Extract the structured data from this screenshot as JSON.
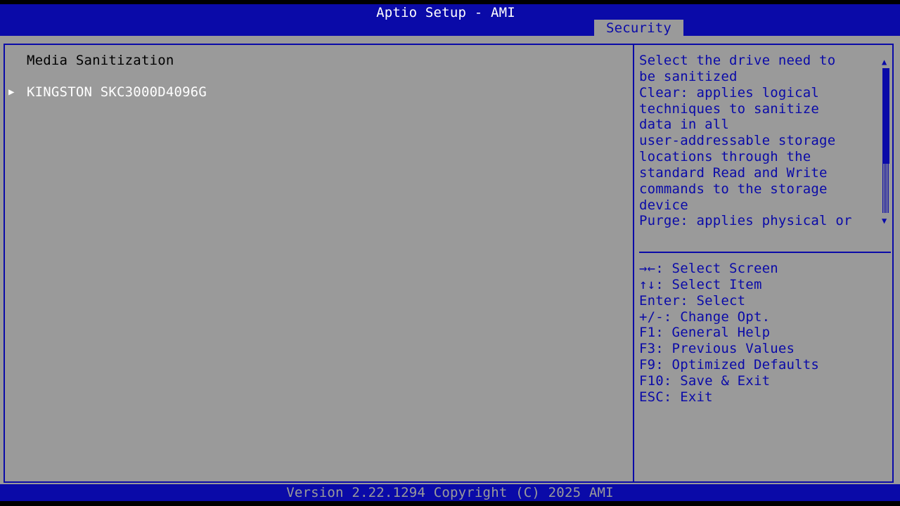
{
  "header": {
    "title": "Aptio Setup - AMI",
    "active_tab": "Security"
  },
  "main": {
    "section_title": "Media Sanitization",
    "items": [
      {
        "pointer_icon": "right-triangle",
        "label": "KINGSTON SKC3000D4096G"
      }
    ]
  },
  "help": {
    "lines": [
      "Select the drive need to",
      "be sanitized",
      "Clear: applies logical",
      "techniques to sanitize",
      "data in all",
      "user-addressable storage",
      "locations through the",
      "standard Read and Write",
      "commands to the storage",
      "device",
      "Purge: applies physical or"
    ],
    "scroll_up_icon": "up-arrow",
    "scroll_down_icon": "down-arrow"
  },
  "keys": [
    "→←: Select Screen",
    "↑↓: Select Item",
    "Enter: Select",
    "+/-: Change Opt.",
    "F1: General Help",
    "F3: Previous Values",
    "F9: Optimized Defaults",
    "F10: Save & Exit",
    "ESC: Exit"
  ],
  "footer": {
    "version": "Version 2.22.1294 Copyright (C) 2025 AMI"
  },
  "colors": {
    "bios_blue": "#0a0aa8",
    "panel_gray": "#9a9a9a",
    "text_white": "#ffffff",
    "text_black": "#000000"
  }
}
